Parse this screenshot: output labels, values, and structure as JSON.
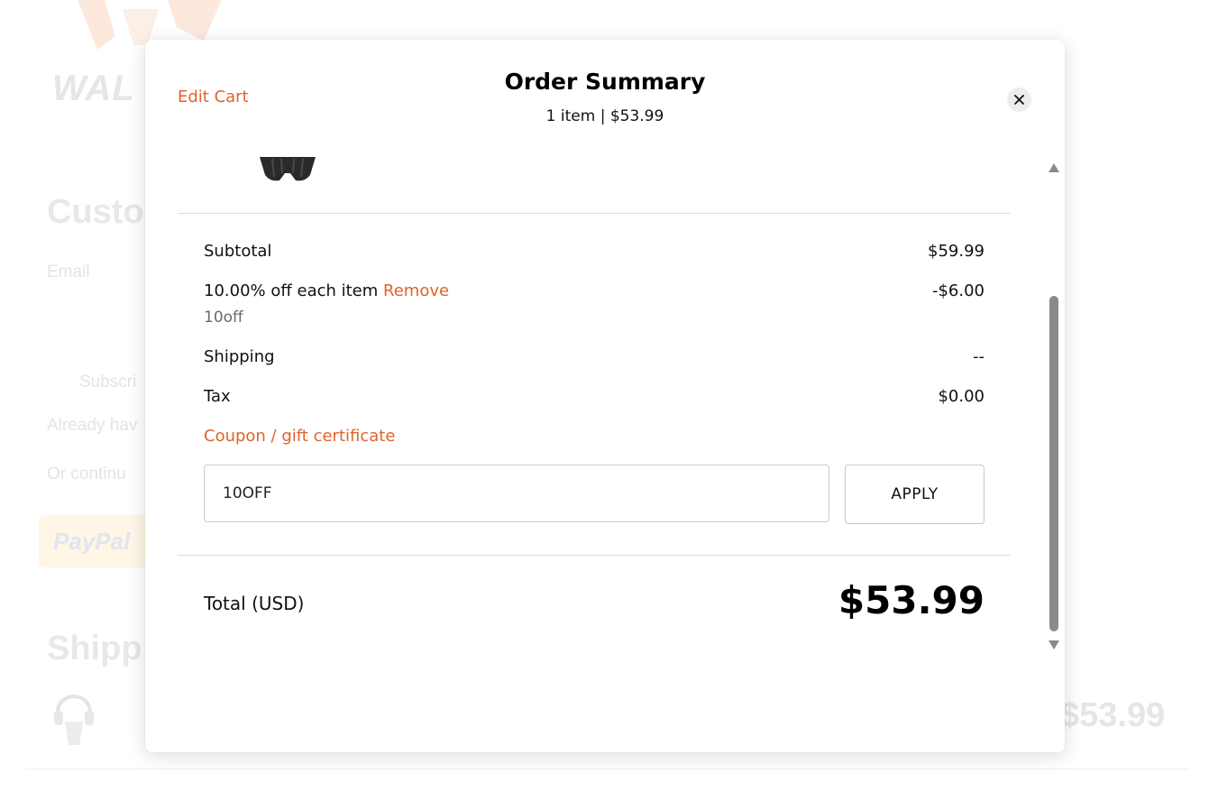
{
  "background": {
    "logo_text": "WAL",
    "heading_customer": "Custo",
    "email_label": "Email",
    "subscribe_text": "Subscri",
    "already_text": "Already hav",
    "continue_text": "Or continu",
    "paypal_text": "PayPal",
    "heading_shipping": "Shipp",
    "price": "$53.99"
  },
  "modal": {
    "edit_cart": "Edit Cart",
    "title": "Order Summary",
    "subtitle": "1 item | $53.99",
    "close_icon": "close-icon"
  },
  "summary": {
    "subtotal_label": "Subtotal",
    "subtotal_value": "$59.99",
    "discount_label": "10.00% off each item",
    "discount_remove": "Remove",
    "discount_value": "-$6.00",
    "discount_code": "10off",
    "shipping_label": "Shipping",
    "shipping_value": "--",
    "tax_label": "Tax",
    "tax_value": "$0.00",
    "coupon_link": "Coupon / gift certificate",
    "coupon_value": "10OFF",
    "apply_label": "APPLY",
    "total_label": "Total (USD)",
    "total_value": "$53.99"
  },
  "colors": {
    "accent": "#e0632a",
    "text": "#111111",
    "muted": "#6b6b6b",
    "border": "#c9c9c9"
  }
}
